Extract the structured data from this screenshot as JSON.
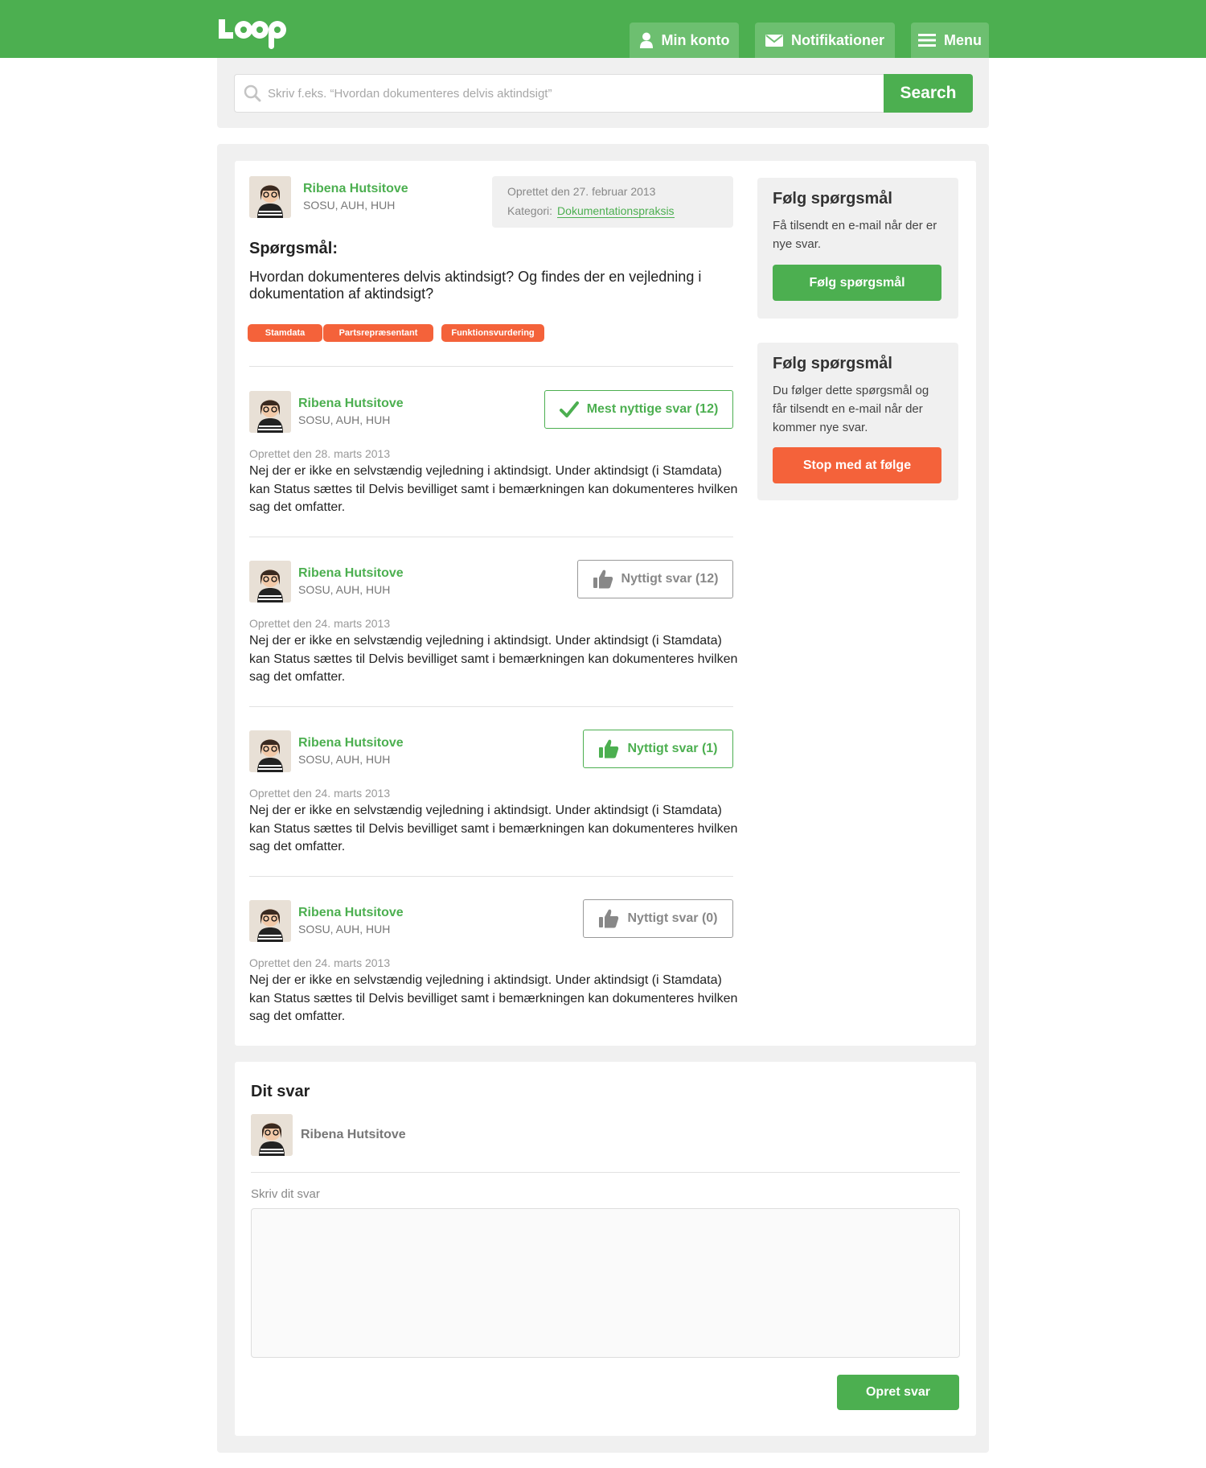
{
  "header": {
    "nav": {
      "account": "Min konto",
      "notifications": "Notifikationer",
      "menu": "Menu"
    }
  },
  "search": {
    "placeholder": "Skriv f.eks. “Hvordan dokumenteres delvis aktindsigt”",
    "button": "Search"
  },
  "question": {
    "author": {
      "name": "Ribena Hutsitove",
      "role": "SOSU, AUH, HUH"
    },
    "created": "Oprettet den 27. februar 2013",
    "category_label": "Kategori:",
    "category": "Dokumentationspraksis",
    "heading": "Spørgsmål:",
    "text": "Hvordan dokumenteres delvis aktindsigt? Og findes der en vejledning i dokumentation af aktindsigt?",
    "tags": [
      "Stamdata",
      "Partsrepræsentant",
      "Funktionsvurdering"
    ]
  },
  "answers": [
    {
      "author": "Ribena Hutsitove",
      "role": "SOSU, AUH, HUH",
      "vote_label": "Mest nyttige svar (12)",
      "vote_style": "check",
      "date": "Oprettet den 28. marts 2013",
      "text": "Nej der er ikke en selvstændig vejledning i aktindsigt. Under aktindsigt (i Stamdata) kan Status sættes til Delvis bevilliget samt i bemærkningen kan dokumenteres hvilken sag det omfatter."
    },
    {
      "author": "Ribena Hutsitove",
      "role": "SOSU, AUH, HUH",
      "vote_label": "Nyttigt svar (12)",
      "vote_style": "thumb-grey",
      "date": "Oprettet den 24. marts 2013",
      "text": "Nej der er ikke en selvstændig vejledning i aktindsigt. Under aktindsigt (i Stamdata) kan Status sættes til Delvis bevilliget samt i bemærkningen kan dokumenteres hvilken sag det omfatter."
    },
    {
      "author": "Ribena Hutsitove",
      "role": "SOSU, AUH, HUH",
      "vote_label": "Nyttigt svar (1)",
      "vote_style": "thumb-green",
      "date": "Oprettet den 24. marts 2013",
      "text": "Nej der er ikke en selvstændig vejledning i aktindsigt. Under aktindsigt (i Stamdata) kan Status sættes til Delvis bevilliget samt i bemærkningen kan dokumenteres hvilken sag det omfatter."
    },
    {
      "author": "Ribena Hutsitove",
      "role": "SOSU, AUH, HUH",
      "vote_label": "Nyttigt svar (0)",
      "vote_style": "thumb-grey",
      "date": "Oprettet den 24. marts 2013",
      "text": "Nej der er ikke en selvstændig vejledning i aktindsigt. Under aktindsigt (i Stamdata) kan Status sættes til Delvis bevilliget samt i bemærkningen kan dokumenteres hvilken sag det omfatter."
    }
  ],
  "sidebar": {
    "follow": {
      "title": "Følg spørgsmål",
      "text": "Få tilsendt en e-mail når der er nye svar.",
      "button": "Følg spørgsmål"
    },
    "following": {
      "title": "Følg spørgsmål",
      "text": "Du følger dette spørgsmål og får tilsendt en e-mail når der kommer nye svar.",
      "button": "Stop med at følge"
    }
  },
  "reply": {
    "title": "Dit svar",
    "author": "Ribena Hutsitove",
    "label": "Skriv dit svar",
    "button": "Opret svar"
  },
  "colors": {
    "brand_green": "#4caf50",
    "tag_orange": "#f4623a",
    "panel_grey": "#f0f0f0"
  }
}
